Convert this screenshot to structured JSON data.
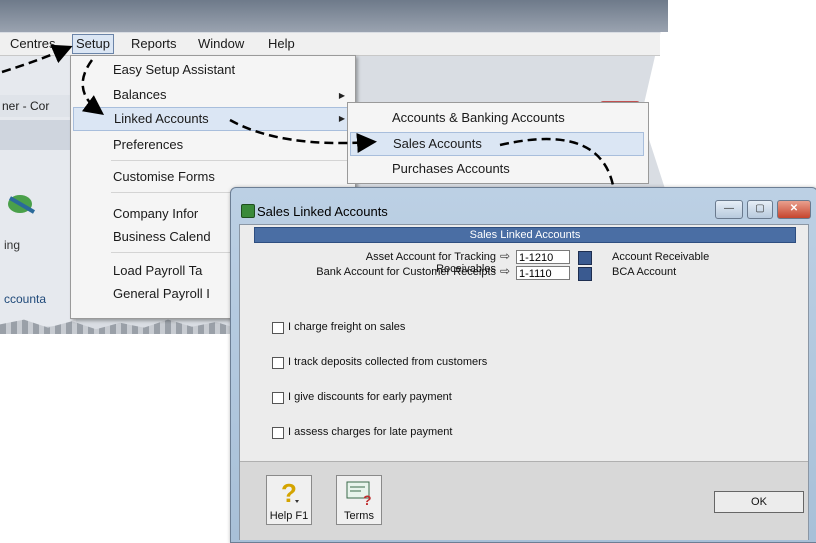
{
  "menubar": {
    "items": [
      "Centres",
      "Setup",
      "Reports",
      "Window",
      "Help"
    ]
  },
  "background_app": {
    "window_title_partial": "ner - Cor",
    "panel_label_partial": "ing",
    "link_partial": "ccounta"
  },
  "setup_menu": {
    "items": [
      {
        "label": "Easy Setup Assistant",
        "has_submenu": false
      },
      {
        "label": "Balances",
        "has_submenu": true
      },
      {
        "label": "Linked Accounts",
        "has_submenu": true,
        "highlighted": true
      },
      {
        "label": "Preferences",
        "has_submenu": false
      },
      {
        "label": "Customise Forms",
        "has_submenu": true
      },
      {
        "label": "Company Infor",
        "has_submenu": false
      },
      {
        "label": "Business Calend",
        "has_submenu": false
      },
      {
        "label": "Load Payroll Ta",
        "has_submenu": false
      },
      {
        "label": "General Payroll I",
        "has_submenu": false
      }
    ]
  },
  "linked_submenu": {
    "items": [
      {
        "label": "Accounts & Banking Accounts"
      },
      {
        "label": "Sales Accounts",
        "highlighted": true
      },
      {
        "label": "Purchases Accounts"
      }
    ]
  },
  "dialog": {
    "title": "Sales Linked Accounts",
    "header": "Sales Linked Accounts",
    "window_buttons": {
      "minimize": "—",
      "maximize": "▢",
      "close": "✕"
    },
    "fields": [
      {
        "label": "Asset Account for Tracking Receivables",
        "value": "1-1210",
        "account_name": "Account Receivable"
      },
      {
        "label": "Bank Account for Customer Receipts",
        "value": "1-1110",
        "account_name": "BCA Account"
      }
    ],
    "checkboxes": [
      {
        "label": "I charge freight on sales",
        "checked": false
      },
      {
        "label": "I track deposits collected from customers",
        "checked": false
      },
      {
        "label": "I give discounts for early payment",
        "checked": false
      },
      {
        "label": "I assess charges for late payment",
        "checked": false
      }
    ],
    "buttons": {
      "help": "Help F1",
      "terms": "Terms",
      "ok": "OK"
    }
  },
  "colors": {
    "header_blue": "#4a6ea4",
    "menu_highlight": "#dbe6f4",
    "dialog_frame": "#bcd0e4"
  }
}
